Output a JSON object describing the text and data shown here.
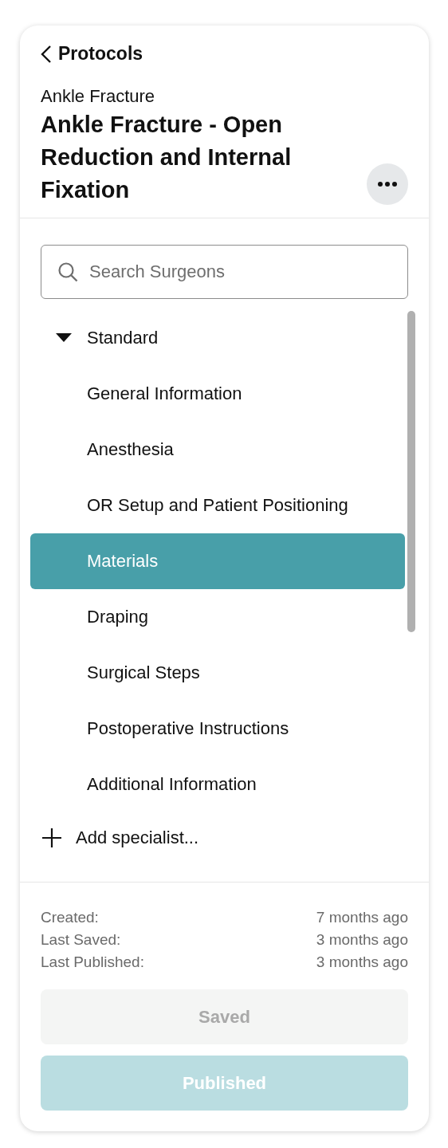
{
  "back_link": {
    "label": "Protocols"
  },
  "header": {
    "category": "Ankle Fracture",
    "title": "Ankle Fracture - Open Reduction and Internal Fixation"
  },
  "search": {
    "placeholder": "Search Surgeons"
  },
  "tree": [
    {
      "label": "Standard",
      "expanded": true,
      "children": [
        {
          "label": "General Information",
          "selected": false
        },
        {
          "label": "Anesthesia",
          "selected": false
        },
        {
          "label": "OR Setup and Patient Positioning",
          "selected": false
        },
        {
          "label": "Materials",
          "selected": true
        },
        {
          "label": "Draping",
          "selected": false
        },
        {
          "label": "Surgical Steps",
          "selected": false
        },
        {
          "label": "Postoperative Instructions",
          "selected": false
        },
        {
          "label": "Additional Information",
          "selected": false
        }
      ]
    }
  ],
  "add_button": {
    "label": "Add specialist..."
  },
  "meta": [
    {
      "label": "Created:",
      "value": "7 months ago"
    },
    {
      "label": "Last Saved:",
      "value": "3 months ago"
    },
    {
      "label": "Last Published:",
      "value": "3 months ago"
    }
  ],
  "buttons": [
    {
      "label": "Saved",
      "kind": "secondary",
      "disabled": true
    },
    {
      "label": "Published",
      "kind": "primary",
      "disabled": true
    }
  ]
}
